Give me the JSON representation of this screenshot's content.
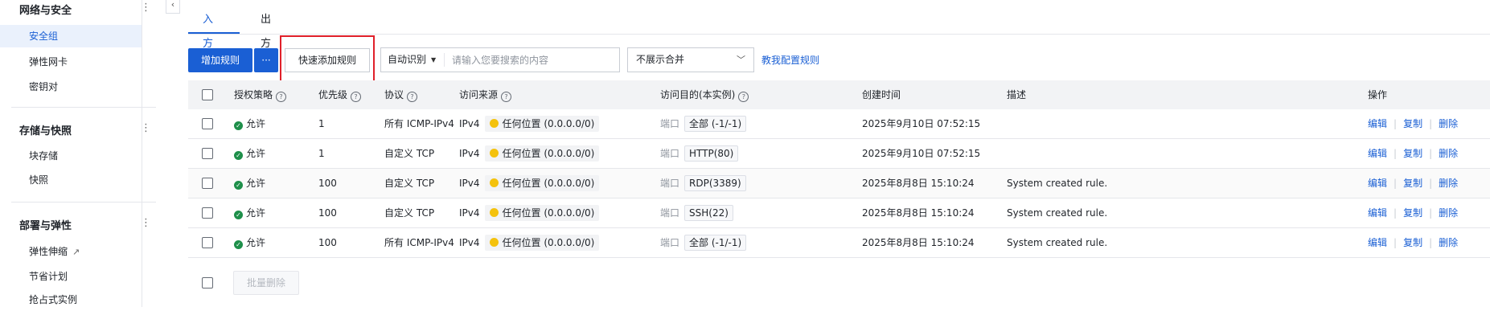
{
  "sidebar": {
    "groups": [
      {
        "title": "网络与安全",
        "items": [
          {
            "label": "安全组",
            "active": true
          },
          {
            "label": "弹性网卡"
          },
          {
            "label": "密钥对"
          }
        ]
      },
      {
        "title": "存储与快照",
        "items": [
          {
            "label": "块存储"
          },
          {
            "label": "快照"
          }
        ]
      },
      {
        "title": "部署与弹性",
        "items": [
          {
            "label": "弹性伸缩",
            "external": true
          },
          {
            "label": "节省计划"
          },
          {
            "label": "抢占式实例"
          }
        ]
      }
    ],
    "more_glyph": "⋮",
    "collapse_glyph": "‹"
  },
  "tabs": [
    {
      "label": "入方向",
      "active": true
    },
    {
      "label": "出方向"
    }
  ],
  "toolbar": {
    "add_rule": "增加规则",
    "more": "···",
    "quick_add": "快速添加规则",
    "search_type": "自动识别",
    "search_placeholder": "请输入您要搜索的内容",
    "merge_select": "不展示合并",
    "teach_link": "教我配置规则"
  },
  "table": {
    "headers": {
      "policy": "授权策略",
      "priority": "优先级",
      "protocol": "协议",
      "source": "访问来源",
      "dest": "访问目的(本实例)",
      "created": "创建时间",
      "desc": "描述",
      "ops": "操作"
    },
    "rows": [
      {
        "policy": "允许",
        "priority": "1",
        "protocol": "所有 ICMP-IPv4",
        "ip": "IPv4",
        "source": "任何位置 (0.0.0.0/0)",
        "port_label": "端口",
        "port": "全部 (-1/-1)",
        "created": "2025年9月10日 07:52:15",
        "desc": ""
      },
      {
        "policy": "允许",
        "priority": "1",
        "protocol": "自定义 TCP",
        "ip": "IPv4",
        "source": "任何位置 (0.0.0.0/0)",
        "port_label": "端口",
        "port": "HTTP(80)",
        "created": "2025年9月10日 07:52:15",
        "desc": ""
      },
      {
        "policy": "允许",
        "priority": "100",
        "protocol": "自定义 TCP",
        "ip": "IPv4",
        "source": "任何位置 (0.0.0.0/0)",
        "port_label": "端口",
        "port": "RDP(3389)",
        "created": "2025年8月8日 15:10:24",
        "desc": "System created rule."
      },
      {
        "policy": "允许",
        "priority": "100",
        "protocol": "自定义 TCP",
        "ip": "IPv4",
        "source": "任何位置 (0.0.0.0/0)",
        "port_label": "端口",
        "port": "SSH(22)",
        "created": "2025年8月8日 15:10:24",
        "desc": "System created rule."
      },
      {
        "policy": "允许",
        "priority": "100",
        "protocol": "所有 ICMP-IPv4",
        "ip": "IPv4",
        "source": "任何位置 (0.0.0.0/0)",
        "port_label": "端口",
        "port": "全部 (-1/-1)",
        "created": "2025年8月8日 15:10:24",
        "desc": "System created rule."
      }
    ],
    "ops": {
      "edit": "编辑",
      "copy": "复制",
      "delete": "删除"
    },
    "bulk_delete": "批量删除"
  }
}
